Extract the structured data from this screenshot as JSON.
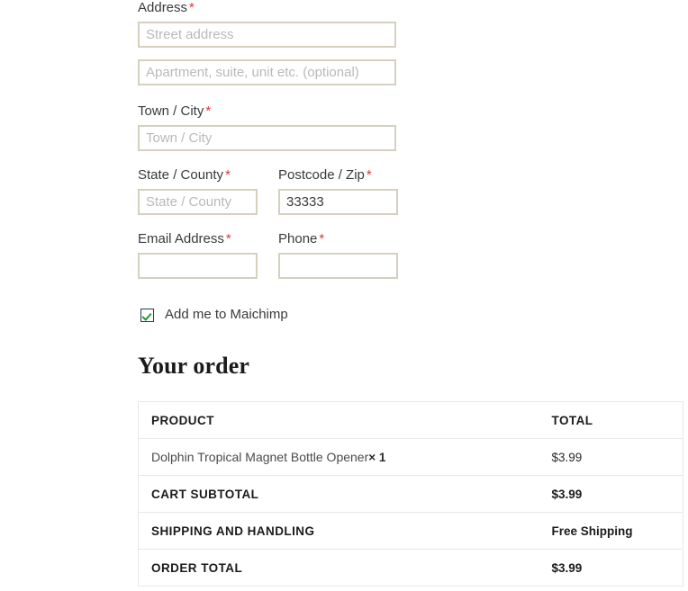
{
  "form": {
    "fields": [
      {
        "label": "Address",
        "required": true,
        "placeholder": "Street address",
        "value": ""
      },
      {
        "label": "",
        "required": false,
        "placeholder": "Apartment, suite, unit etc. (optional)",
        "value": ""
      },
      {
        "label": "Town / City",
        "required": true,
        "placeholder": "Town / City",
        "value": ""
      },
      {
        "label": "State / County",
        "required": true,
        "placeholder": "State / County",
        "value": ""
      },
      {
        "label": "Postcode / Zip",
        "required": true,
        "placeholder": "",
        "value": "33333"
      },
      {
        "label": "Email Address",
        "required": true,
        "placeholder": "",
        "value": ""
      },
      {
        "label": "Phone",
        "required": true,
        "placeholder": "",
        "value": ""
      }
    ],
    "required_marker": "*",
    "newsletter": {
      "label": "Add me to Maichimp",
      "checked": true
    }
  },
  "order": {
    "heading": "Your order",
    "columns": {
      "product": "PRODUCT",
      "total": "TOTAL"
    },
    "items": [
      {
        "name": "Dolphin Tropical Magnet Bottle Opener",
        "quantity": "× 1",
        "price": "$3.99"
      }
    ],
    "summary": [
      {
        "label": "CART SUBTOTAL",
        "value": "$3.99"
      },
      {
        "label": "SHIPPING AND HANDLING",
        "value": "Free Shipping"
      },
      {
        "label": "ORDER TOTAL",
        "value": "$3.99"
      }
    ]
  },
  "colors": {
    "required": "#e03535",
    "input_border": "#d5d0c0",
    "table_border": "#e8e8e8",
    "checkmark": "#2a9634"
  }
}
